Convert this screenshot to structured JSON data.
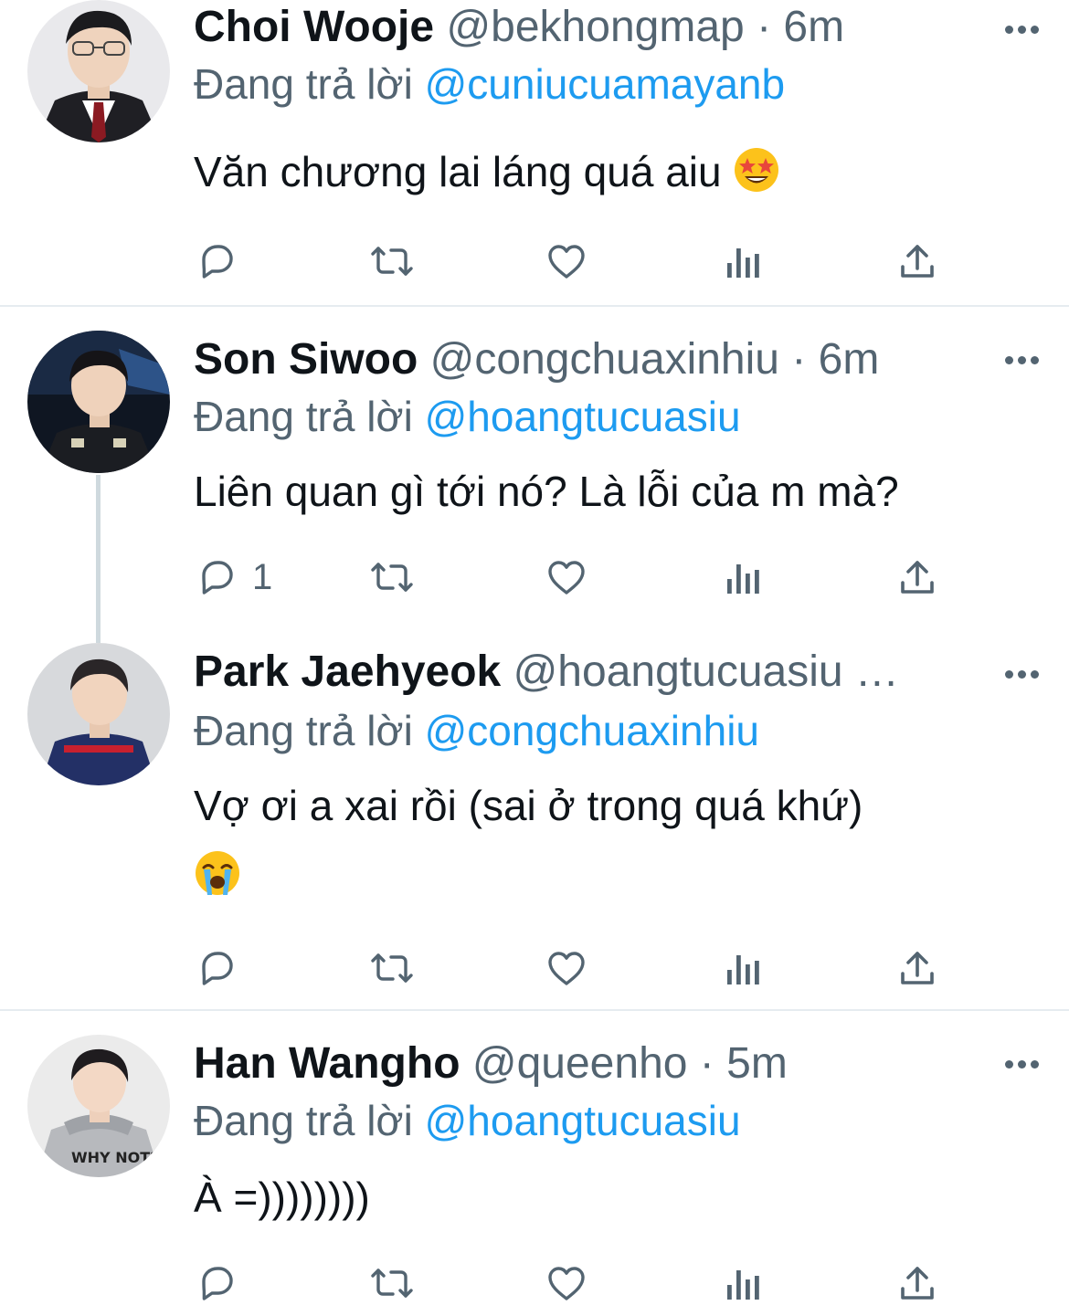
{
  "tweets": [
    {
      "name": "Choi Wooje",
      "handle": "@bekhongmap",
      "separator": "·",
      "time": "6m",
      "reply_prefix": "Đang trả lời",
      "reply_to": "@cuniucuamayanb",
      "text": "Văn chương lai láng quá aiu",
      "emoji": "star-struck-emoji",
      "reply_count": ""
    },
    {
      "name": "Son Siwoo",
      "handle": "@congchuaxinhiu",
      "separator": "·",
      "time": "6m",
      "reply_prefix": "Đang trả lời",
      "reply_to": "@hoangtucuasiu",
      "text": "Liên quan gì tới nó? Là lỗi của m mà?",
      "reply_count": "1"
    },
    {
      "name": "Park Jaehyeok",
      "handle": "@hoangtucuasiu",
      "separator": "",
      "time": "…",
      "reply_prefix": "Đang trả lời",
      "reply_to": "@congchuaxinhiu",
      "text": "Vợ ơi a xai rồi (sai ở trong quá khứ)",
      "emoji": "loudly-crying-emoji",
      "reply_count": ""
    },
    {
      "name": "Han Wangho",
      "handle": "@queenho",
      "separator": "·",
      "time": "5m",
      "reply_prefix": "Đang trả lời",
      "reply_to": "@hoangtucuasiu",
      "text": "À =))))))))",
      "reply_count": ""
    }
  ],
  "icons": {
    "reply": "reply-icon",
    "retweet": "retweet-icon",
    "like": "like-icon",
    "views": "views-icon",
    "share": "share-icon",
    "more": "more-icon"
  },
  "colors": {
    "text": "#0f1419",
    "secondary": "#536471",
    "mention": "#1d9bf0",
    "divider": "#e6ecf0",
    "thread_line": "#cfd9de"
  }
}
